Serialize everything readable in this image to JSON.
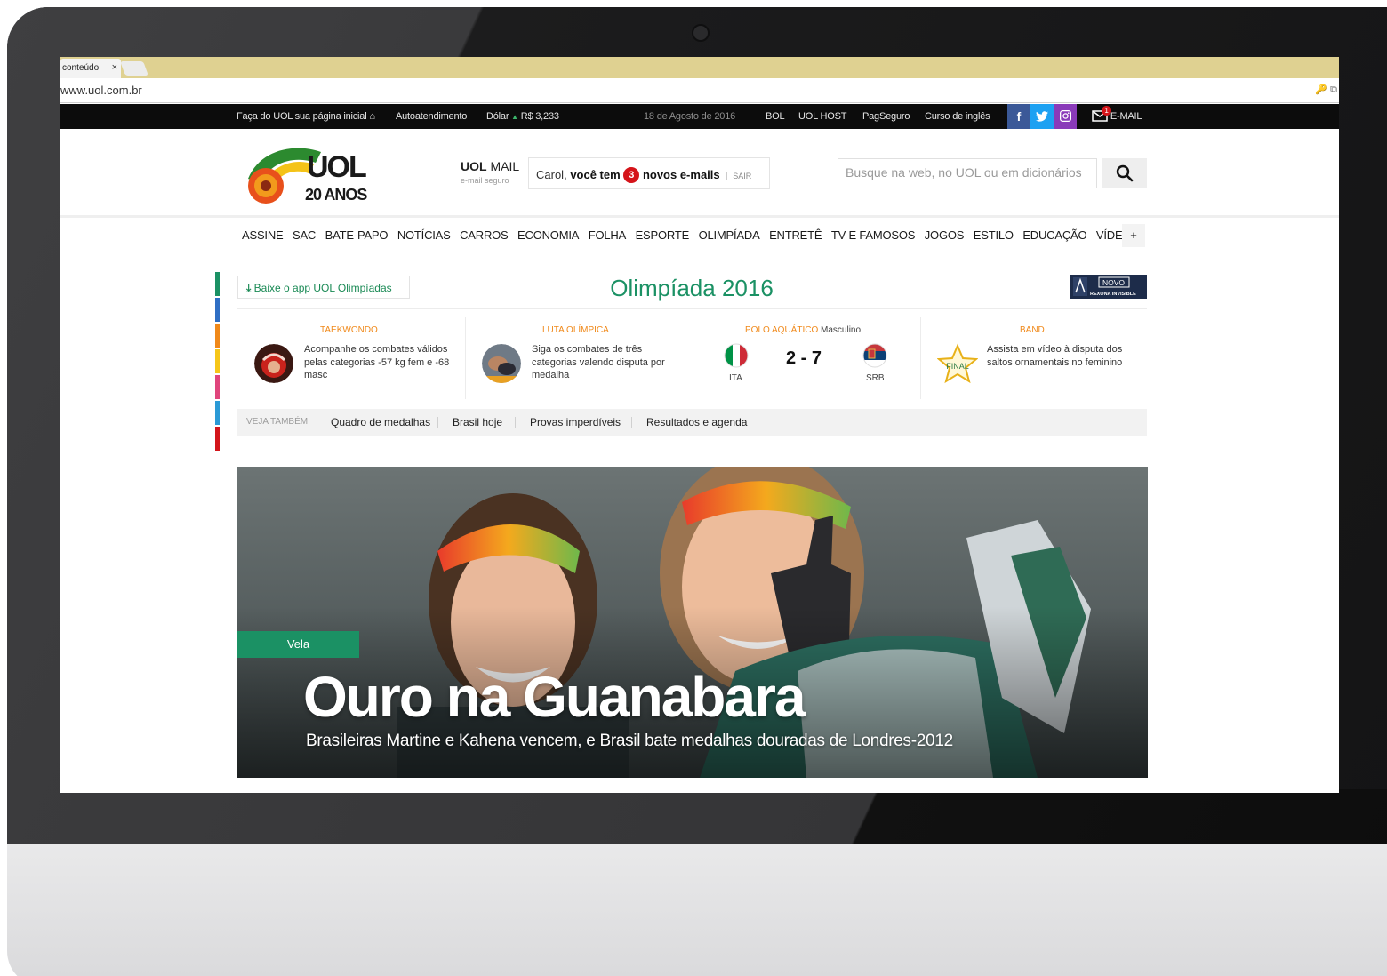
{
  "browser": {
    "tab_title": "conteúdo",
    "tab_close": "×",
    "url": "www.uol.com.br"
  },
  "topbar": {
    "homepage": "Faça do UOL sua página inicial",
    "autoatendimento": "Autoatendimento",
    "dolar_label": "Dólar",
    "dolar_value": "R$ 3,233",
    "date": "18 de Agosto de 2016",
    "links": [
      "BOL",
      "UOL HOST",
      "PagSeguro",
      "Curso de inglês"
    ],
    "email_label": "E-MAIL",
    "email_badge": "1"
  },
  "header": {
    "logo_text": "UOL",
    "logo_years": "20 ANOS",
    "mail_brand": "UOL",
    "mail_word": "MAIL",
    "mail_sub": "e-mail seguro",
    "mail_greeting": "Carol,",
    "mail_voce": "você tem",
    "mail_count": "3",
    "mail_novos": "novos e-mails",
    "mail_sair": "SAIR",
    "search_placeholder": "Busque na web, no UOL ou em dicionários"
  },
  "nav": {
    "items": [
      "ASSINE",
      "SAC",
      "BATE-PAPO",
      "NOTÍCIAS",
      "CARROS",
      "ECONOMIA",
      "FOLHA",
      "ESPORTE",
      "OLIMPÍADA",
      "ENTRETÊ",
      "TV E FAMOSOS",
      "JOGOS",
      "ESTILO",
      "EDUCAÇÃO",
      "VÍDEOS"
    ],
    "more": "+"
  },
  "olympics": {
    "app_button": "Baixe o app UOL Olimpíadas",
    "title": "Olimpíada 2016",
    "sponsor_badge": "NOVO",
    "sponsor_text": "REXONA INVISIBLE",
    "bar_colors": [
      "#1b9164",
      "#2f6fc4",
      "#f0891a",
      "#f6c619",
      "#e0457c",
      "#2b9ad6",
      "#d3151b"
    ],
    "cards": [
      {
        "category": "TAEKWONDO",
        "text": "Acompanhe os combates válidos pelas categorias -57 kg fem e -68 masc"
      },
      {
        "category": "LUTA OLÍMPICA",
        "text": "Siga os combates de três categorias valendo disputa por medalha"
      },
      {
        "category": "BAND",
        "text": "Assista em vídeo à disputa dos saltos ornamentais no feminino",
        "badge": "FINAL"
      }
    ],
    "match": {
      "category": "POLO AQUÁTICO",
      "gender": "Masculino",
      "score": "2 - 7",
      "team_a": "ITA",
      "team_b": "SRB"
    },
    "see_also_label": "VEJA TAMBÉM:",
    "see_also": [
      "Quadro de medalhas",
      "Brasil hoje",
      "Provas imperdíveis",
      "Resultados e agenda"
    ]
  },
  "hero": {
    "tag": "Vela",
    "title": "Ouro na Guanabara",
    "subtitle": "Brasileiras Martine e Kahena vencem, e Brasil bate medalhas douradas de Londres-2012"
  }
}
